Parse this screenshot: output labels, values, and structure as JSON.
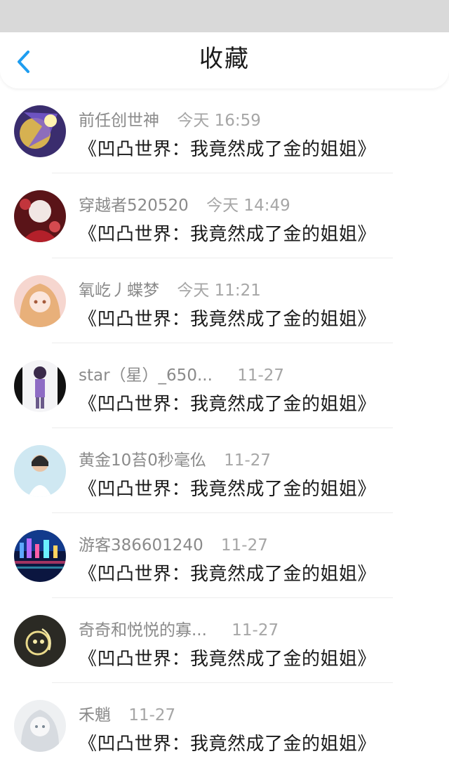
{
  "header": {
    "title": "收藏",
    "back_icon": "chevron-left-icon",
    "accent": "#1e9df0"
  },
  "items": [
    {
      "name": "前任创世神",
      "time": "今天 16:59",
      "title": "《凹凸世界：我竟然成了金的姐姐》"
    },
    {
      "name": "穿越者520520",
      "time": "今天 14:49",
      "title": "《凹凸世界：我竟然成了金的姐姐》"
    },
    {
      "name": "氧屹丿蝶梦",
      "time": "今天 11:21",
      "title": "《凹凸世界：我竟然成了金的姐姐》"
    },
    {
      "name": "star（星）_650...",
      "time": "11-27",
      "title": "《凹凸世界：我竟然成了金的姐姐》"
    },
    {
      "name": "黄金10苔0秒毫仫",
      "time": "11-27",
      "title": "《凹凸世界：我竟然成了金的姐姐》"
    },
    {
      "name": "游客386601240",
      "time": "11-27",
      "title": "《凹凸世界：我竟然成了金的姐姐》"
    },
    {
      "name": "奇奇和悦悦的寡...",
      "time": "11-27",
      "title": "《凹凸世界：我竟然成了金的姐姐》"
    },
    {
      "name": "禾魈",
      "time": "11-27",
      "title": "《凹凸世界：我竟然成了金的姐姐》"
    }
  ]
}
